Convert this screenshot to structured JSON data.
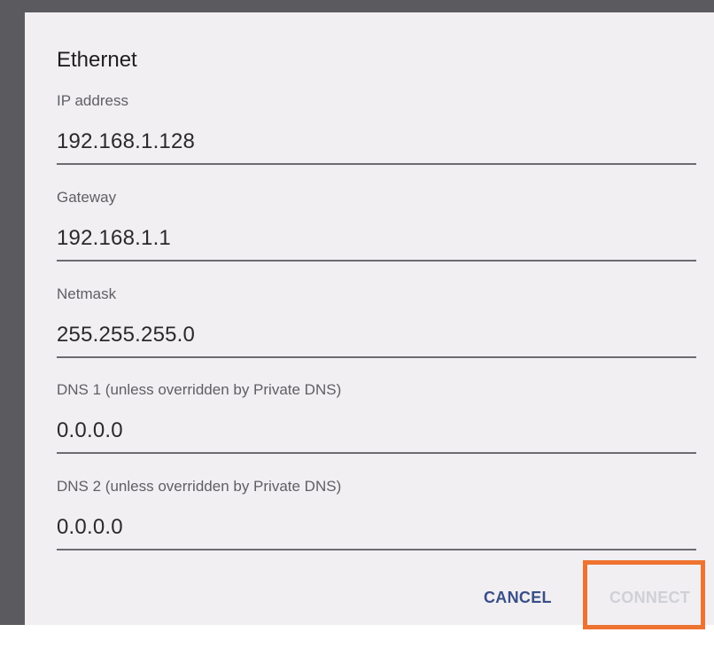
{
  "dialog": {
    "title": "Ethernet",
    "fields": [
      {
        "label": "IP address",
        "value": "192.168.1.128"
      },
      {
        "label": "Gateway",
        "value": "192.168.1.1"
      },
      {
        "label": "Netmask",
        "value": "255.255.255.0"
      },
      {
        "label": "DNS 1 (unless overridden by Private DNS)",
        "value": "0.0.0.0"
      },
      {
        "label": "DNS 2 (unless overridden by Private DNS)",
        "value": "0.0.0.0"
      }
    ],
    "actions": {
      "cancel_label": "CANCEL",
      "connect_label": "CONNECT"
    }
  },
  "colors": {
    "dialog_background": "#f1eff2",
    "scrim": "#5b5a5e",
    "cancel_text": "#3a4f88",
    "connect_disabled_text": "#cfd1d6",
    "highlight_outline": "#ee7330"
  }
}
